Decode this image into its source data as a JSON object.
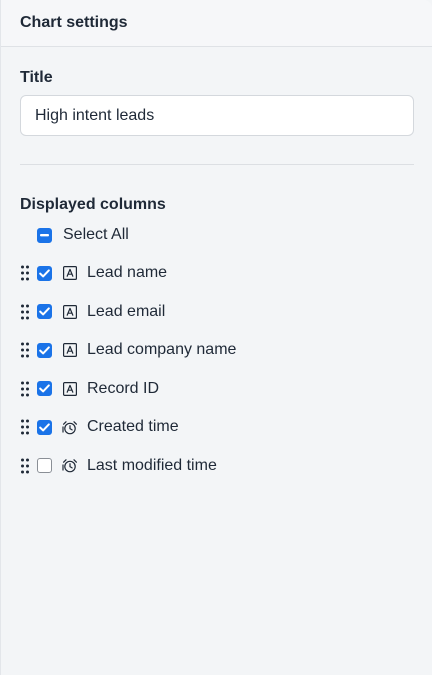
{
  "header": {
    "title": "Chart settings"
  },
  "title_field": {
    "label": "Title",
    "value": "High intent leads"
  },
  "columns": {
    "label": "Displayed columns",
    "select_all": {
      "label": "Select All",
      "state": "indeterminate"
    },
    "items": [
      {
        "label": "Lead name",
        "checked": true,
        "type_icon": "text-type-icon"
      },
      {
        "label": "Lead email",
        "checked": true,
        "type_icon": "text-type-icon"
      },
      {
        "label": "Lead company name",
        "checked": true,
        "type_icon": "text-type-icon"
      },
      {
        "label": "Record ID",
        "checked": true,
        "type_icon": "text-type-icon"
      },
      {
        "label": "Created time",
        "checked": true,
        "type_icon": "datetime-type-icon"
      },
      {
        "label": "Last modified time",
        "checked": false,
        "type_icon": "datetime-type-icon"
      }
    ]
  },
  "colors": {
    "accent": "#1a73e8",
    "background": "#f3f5f7",
    "text": "#1f2937"
  }
}
